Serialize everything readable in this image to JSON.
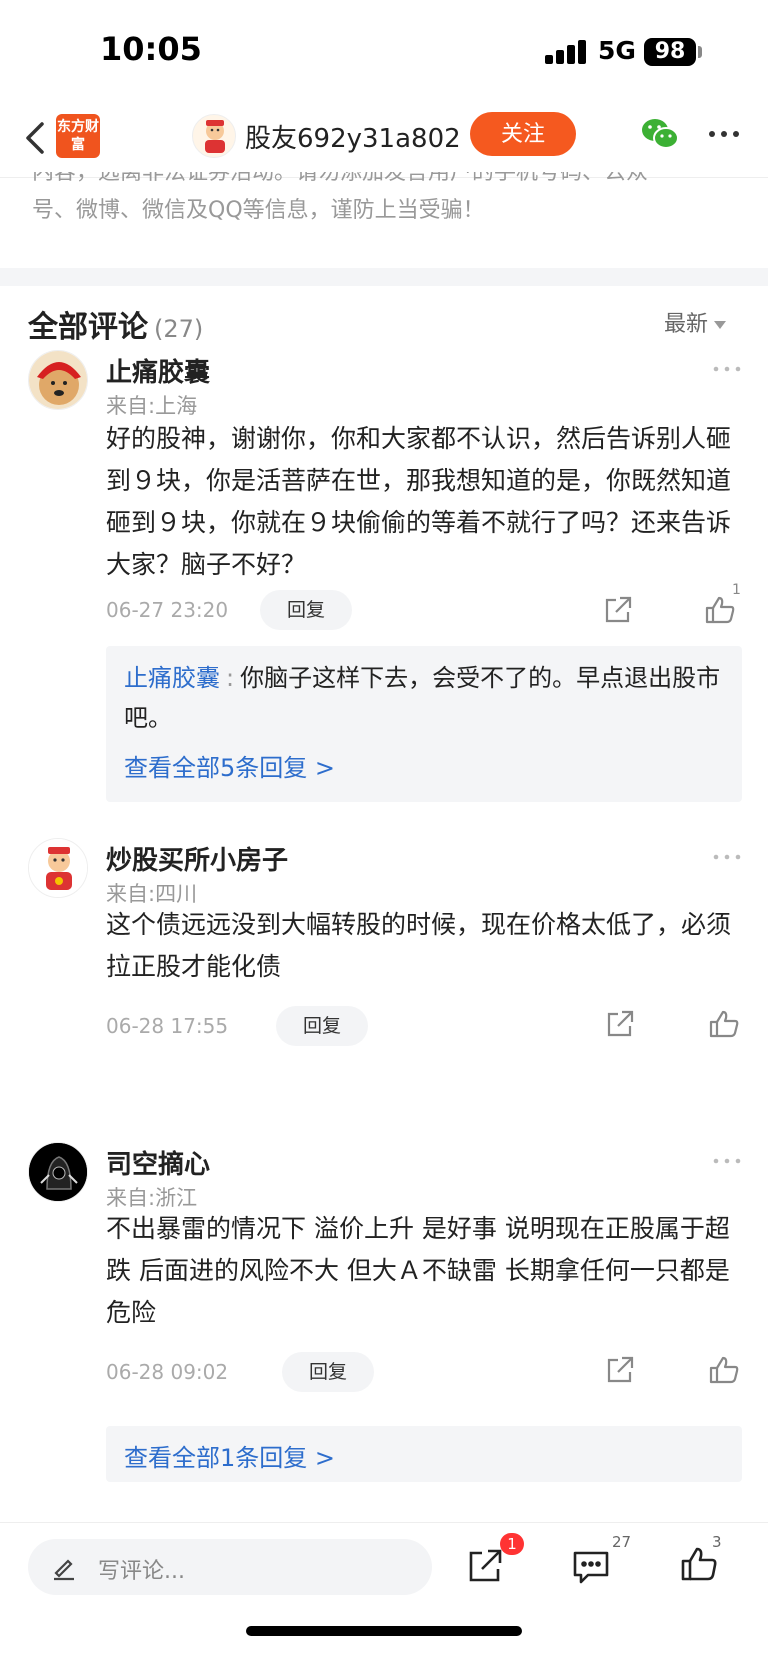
{
  "status_bar": {
    "time": "10:05",
    "network": "5G",
    "battery": "98"
  },
  "nav": {
    "logo": "东方财富",
    "username": "股友692y31a802",
    "follow_label": "关注"
  },
  "notice": {
    "line1": "内容，远离非法证券活动。请勿添加发言用户的手机号码、公众",
    "line2": "号、微博、微信及QQ等信息，谨防上当受骗！"
  },
  "comments_header": {
    "title": "全部评论",
    "count": "(27)",
    "sort": "最新"
  },
  "comments": [
    {
      "name": "止痛胶囊",
      "location": "来自:上海",
      "text": "好的股神，谢谢你，你和大家都不认识，然后告诉别人砸到９块，你是活菩萨在世，那我想知道的是，你既然知道砸到９块，你就在９块偷偷的等着不就行了吗？还来告诉大家？脑子不好？",
      "date": "06-27 23:20",
      "reply_label": "回复",
      "likes": "1",
      "sub_reply": {
        "name": "止痛胶囊",
        "colon": ":",
        "text": "你脑子这样下去，会受不了的。早点退出股市吧。"
      },
      "view_all": "查看全部5条回复 >"
    },
    {
      "name": "炒股买所小房子",
      "location": "来自:四川",
      "text": "这个债远远没到大幅转股的时候，现在价格太低了，必须拉正股才能化债",
      "date": "06-28 17:55",
      "reply_label": "回复"
    },
    {
      "name": "司空摘心",
      "location": "来自:浙江",
      "text": "不出暴雷的情况下  溢价上升  是好事  说明现在正股属于超跌   后面进的风险不大   但大Ａ不缺雷  长期拿任何一只都是危险",
      "date": "06-28 09:02",
      "reply_label": "回复",
      "view_all": "查看全部1条回复 >"
    }
  ],
  "bottom_bar": {
    "placeholder": "写评论...",
    "share_badge": "1",
    "comment_count": "27",
    "like_count": "3"
  }
}
